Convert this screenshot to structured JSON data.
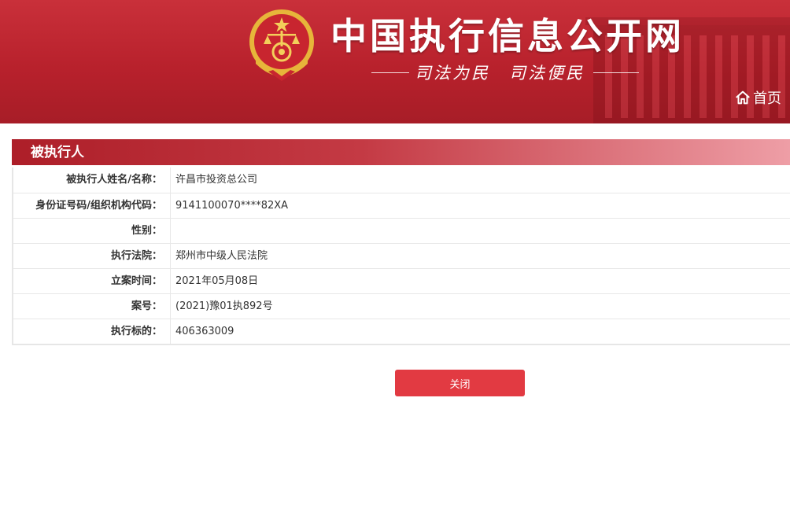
{
  "header": {
    "site_title": "中国执行信息公开网",
    "motto": "司法为民　司法便民",
    "home_label": "首页"
  },
  "section": {
    "title": "被执行人"
  },
  "rows": [
    {
      "label": "被执行人姓名/名称：",
      "value": "许昌市投资总公司"
    },
    {
      "label": "身份证号码/组织机构代码：",
      "value": "9141100070****82XA"
    },
    {
      "label": "性别：",
      "value": ""
    },
    {
      "label": "执行法院：",
      "value": "郑州市中级人民法院"
    },
    {
      "label": "立案时间：",
      "value": "2021年05月08日"
    },
    {
      "label": "案号：",
      "value": "(2021)豫01执892号"
    },
    {
      "label": "执行标的：",
      "value": "406363009"
    }
  ],
  "actions": {
    "close_label": "关闭"
  },
  "colors": {
    "brand_red": "#b8212c",
    "button_red": "#e23a42",
    "emblem_gold": "#e7b53a"
  },
  "icons": {
    "emblem": "court-emblem-icon",
    "home": "home-icon"
  }
}
